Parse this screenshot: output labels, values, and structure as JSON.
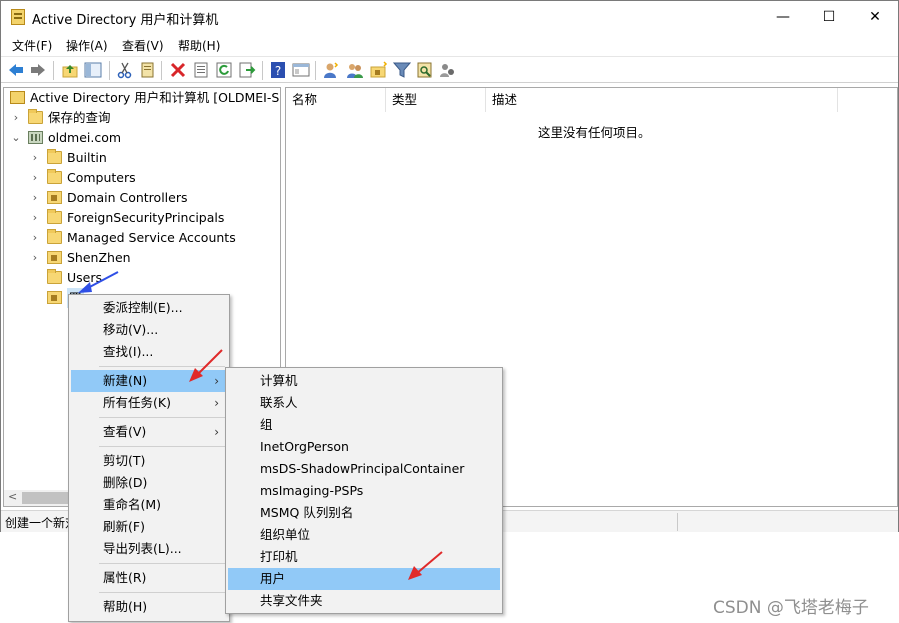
{
  "window": {
    "title": "Active Directory 用户和计算机",
    "controls": {
      "minimize": "—",
      "maximize": "☐",
      "close": "✕"
    }
  },
  "menubar": [
    "文件(F)",
    "操作(A)",
    "查看(V)",
    "帮助(H)"
  ],
  "toolbar": {
    "icons": [
      "back-arrow-icon",
      "forward-arrow-icon",
      "up-folder-icon",
      "show-hide-tree-icon",
      "cut-icon",
      "copy-icon",
      "delete-icon",
      "properties-icon",
      "refresh-icon",
      "export-list-icon",
      "help-icon",
      "console-view-icon",
      "new-user-icon",
      "new-group-icon",
      "new-ou-icon",
      "filter-icon",
      "find-icon",
      "delegate-icon"
    ]
  },
  "tree": {
    "root": "Active Directory 用户和计算机 [OLDMEI-SER",
    "saved_queries": "保存的查询",
    "domain": "oldmei.com",
    "children": [
      "Builtin",
      "Computers",
      "Domain Controllers",
      "ForeignSecurityPrincipals",
      "Managed Service Accounts",
      "ShenZhen",
      "Users"
    ],
    "selected_partial": "四"
  },
  "list": {
    "columns": [
      "名称",
      "类型",
      "描述"
    ],
    "empty_message": "这里没有任何项目。"
  },
  "statusbar": {
    "text": "创建一个新对"
  },
  "context_menu": {
    "items": [
      "委派控制(E)...",
      "移动(V)...",
      "查找(I)...",
      "新建(N)",
      "所有任务(K)",
      "查看(V)",
      "剪切(T)",
      "删除(D)",
      "重命名(M)",
      "刷新(F)",
      "导出列表(L)...",
      "属性(R)",
      "帮助(H)"
    ],
    "highlighted": "新建(N)"
  },
  "submenu": {
    "items": [
      "计算机",
      "联系人",
      "组",
      "InetOrgPerson",
      "msDS-ShadowPrincipalContainer",
      "msImaging-PSPs",
      "MSMQ 队列别名",
      "组织单位",
      "打印机",
      "用户",
      "共享文件夹"
    ],
    "highlighted": "用户"
  },
  "watermark": "CSDN @飞塔老梅子",
  "colors": {
    "highlight": "#91c9f7",
    "folder": "#f7d774",
    "red_arrow": "#e02a2a",
    "blue_arrow": "#2f4fe6"
  }
}
